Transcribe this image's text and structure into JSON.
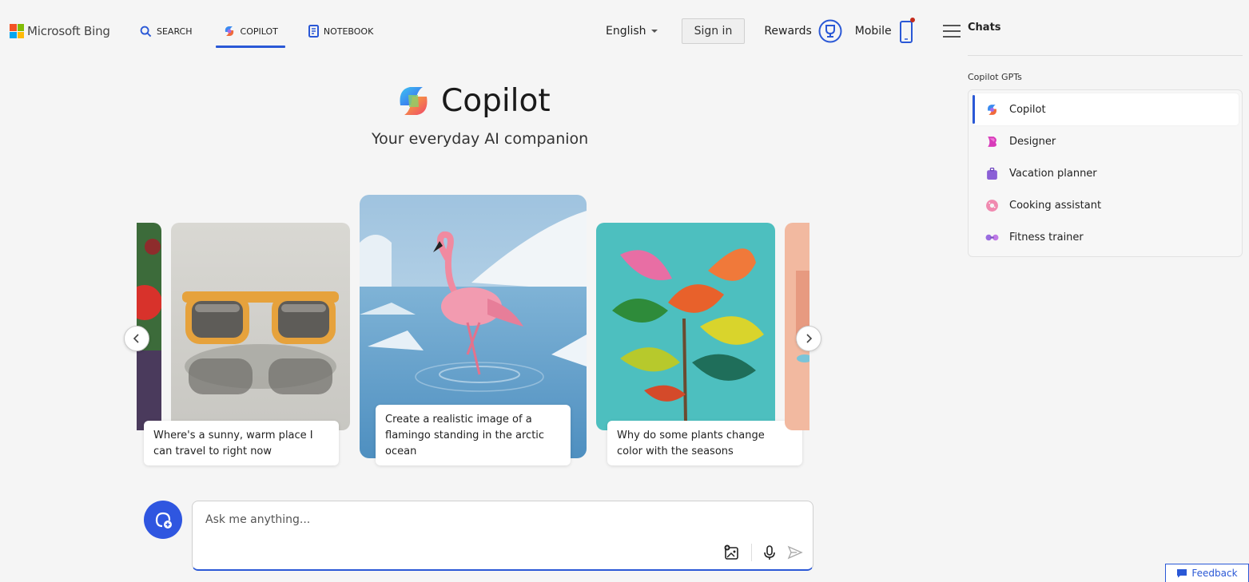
{
  "header": {
    "brand": "Microsoft Bing",
    "nav": [
      {
        "label": "SEARCH",
        "icon": "search-icon"
      },
      {
        "label": "COPILOT",
        "icon": "copilot-icon",
        "active": true
      },
      {
        "label": "NOTEBOOK",
        "icon": "notebook-icon"
      }
    ],
    "language": "English",
    "signin": "Sign in",
    "rewards": "Rewards",
    "mobile": "Mobile"
  },
  "hero": {
    "title": "Copilot",
    "tagline": "Your everyday AI companion"
  },
  "carousel": {
    "cards": [
      {
        "caption": "Where's a sunny, warm place I can travel to right now",
        "image": "sunglasses"
      },
      {
        "caption": "Create a realistic image of a flamingo standing in the arctic ocean",
        "image": "flamingo"
      },
      {
        "caption": "Why do some plants change color with the seasons",
        "image": "fiddle-leaf-plant"
      }
    ]
  },
  "input": {
    "placeholder": "Ask me anything..."
  },
  "sidebar": {
    "title": "Chats",
    "section": "Copilot GPTs",
    "items": [
      {
        "label": "Copilot",
        "icon": "copilot-icon",
        "active": true
      },
      {
        "label": "Designer",
        "icon": "designer-icon"
      },
      {
        "label": "Vacation planner",
        "icon": "suitcase-icon"
      },
      {
        "label": "Cooking assistant",
        "icon": "donut-icon"
      },
      {
        "label": "Fitness trainer",
        "icon": "dumbbell-icon"
      }
    ]
  },
  "feedback": "Feedback",
  "colors": {
    "accent": "#2a58d6",
    "background": "#f5f5f5"
  }
}
